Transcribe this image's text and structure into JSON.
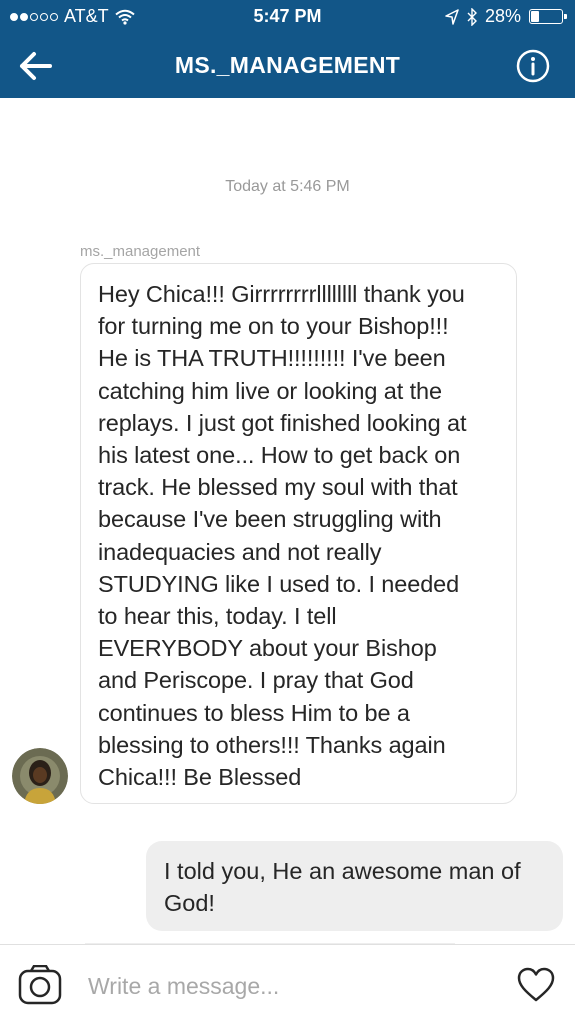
{
  "status_bar": {
    "carrier": "AT&T",
    "time": "5:47 PM",
    "battery": "28%",
    "battery_level": 0.28,
    "signal_bars": 2
  },
  "nav": {
    "title": "MS._MANAGEMENT",
    "back_icon": "arrow-left-icon",
    "info_icon": "info-icon"
  },
  "conversation": {
    "timestamp": "Today at 5:46 PM",
    "incoming": {
      "sender": "ms._management",
      "lines": [
        "Hey Chica!!! Girrrrrrrrllllllll thank you",
        "for turning me on to your Bishop!!!",
        "He is THA TRUTH!!!!!!!!! I've been",
        "catching him live or looking at the",
        "replays. I just got finished looking at",
        "his latest one... How to get back on",
        "track. He blessed my soul with that",
        "because I've been struggling with",
        "inadequacies and not really",
        "STUDYING like I used to. I needed",
        "to hear this, today. I tell",
        "EVERYBODY about your Bishop",
        "and Periscope. I pray that God",
        "continues to bless Him to be a",
        "blessing to others!!! Thanks again",
        "Chica!!! Be Blessed"
      ]
    },
    "outgoing": {
      "lines": [
        "I told you, He an awesome man of",
        "God!"
      ]
    }
  },
  "composer": {
    "placeholder": "Write a message...",
    "camera_icon": "camera-icon",
    "heart_icon": "heart-icon"
  },
  "colors": {
    "header_bg": "#125688",
    "outgoing_bubble": "#eeeeee",
    "incoming_border": "#e3e3e3",
    "timestamp_text": "#999999"
  }
}
